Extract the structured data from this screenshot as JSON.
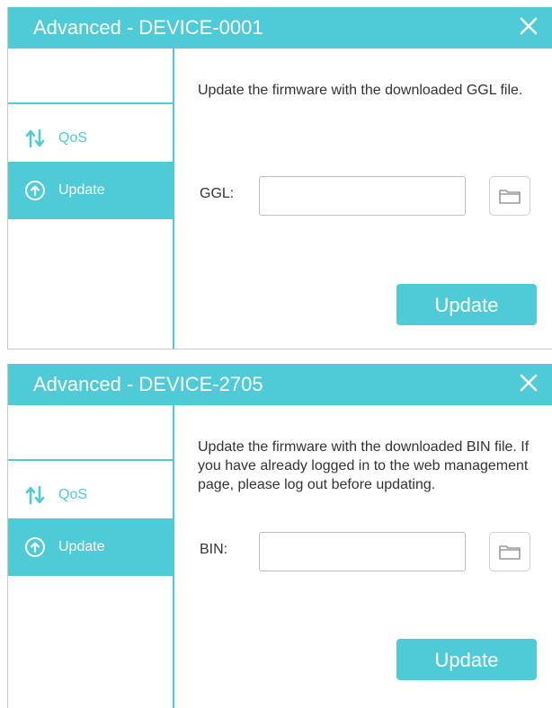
{
  "colors": {
    "accent": "#4ecbd6",
    "text": "#333333",
    "border": "#bdbdbd"
  },
  "dialogs": [
    {
      "title": "Advanced - DEVICE-0001",
      "close_icon": "close-icon",
      "nav": [
        {
          "label": "QoS",
          "icon": "sort-arrows-icon",
          "selected": false
        },
        {
          "label": "Update",
          "icon": "upload-circle-icon",
          "selected": true
        }
      ],
      "description": "Update the firmware with the downloaded GGL file.",
      "field_label": "GGL:",
      "field_value": "",
      "browse_icon": "folder-icon",
      "button_label": "Update"
    },
    {
      "title": "Advanced - DEVICE-2705",
      "close_icon": "close-icon",
      "nav": [
        {
          "label": "QoS",
          "icon": "sort-arrows-icon",
          "selected": false
        },
        {
          "label": "Update",
          "icon": "upload-circle-icon",
          "selected": true
        }
      ],
      "description": "Update the firmware with the downloaded BIN file. If you have already logged in to the web management page, please log out before updating.",
      "field_label": "BIN:",
      "field_value": "",
      "browse_icon": "folder-icon",
      "button_label": "Update"
    }
  ]
}
